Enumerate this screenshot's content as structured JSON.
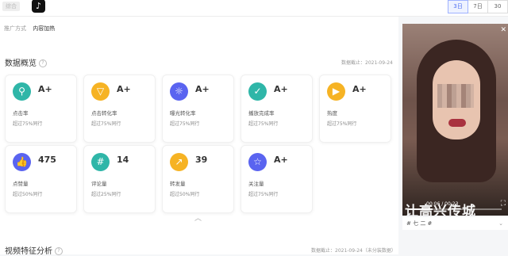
{
  "topbar": {
    "tag": "综合",
    "logo_glyph": "♪",
    "time_range": [
      "3日",
      "7日",
      "30"
    ],
    "active_range": "3日"
  },
  "crumb": {
    "label": "推广方式",
    "current": "内容加热"
  },
  "overview": {
    "title": "数据概览",
    "help": "?",
    "deadline": "数据截止：2021-09-24"
  },
  "cards": [
    {
      "icon": "location-pin-icon",
      "glyph": "⚲",
      "color": "#2fb6a8",
      "value": "A+",
      "label": "点击率",
      "sub": "超过75%同行"
    },
    {
      "icon": "funnel-icon",
      "glyph": "▽",
      "color": "#f6b324",
      "value": "A+",
      "label": "点击转化率",
      "sub": "超过75%同行"
    },
    {
      "icon": "sun-icon",
      "glyph": "☼",
      "color": "#5a64f0",
      "value": "A+",
      "label": "曝光转化率",
      "sub": "超过75%同行"
    },
    {
      "icon": "check-icon",
      "glyph": "✓",
      "color": "#2fb6a8",
      "value": "A+",
      "label": "播放完成率",
      "sub": "超过75%同行"
    },
    {
      "icon": "play-icon",
      "glyph": "▶",
      "color": "#f6b324",
      "value": "A+",
      "label": "热度",
      "sub": "超过75%同行"
    },
    {
      "icon": "thumbs-up-icon",
      "glyph": "👍",
      "color": "#5a64f0",
      "value": "475",
      "label": "点赞量",
      "sub": "超过50%同行"
    },
    {
      "icon": "hashtag-icon",
      "glyph": "#",
      "color": "#2fb6a8",
      "value": "14",
      "label": "评论量",
      "sub": "超过25%同行"
    },
    {
      "icon": "share-icon",
      "glyph": "↗",
      "color": "#f6b324",
      "value": "39",
      "label": "转发量",
      "sub": "超过50%同行"
    },
    {
      "icon": "star-icon",
      "glyph": "☆",
      "color": "#5a64f0",
      "value": "A+",
      "label": "关注量",
      "sub": "超过75%同行"
    }
  ],
  "collapse_glyph": "︿",
  "video_analysis": {
    "title": "视频特征分析",
    "help": "?",
    "deadline": "数据截止：2021-09-24（未分装数据）"
  },
  "video": {
    "time": "00:06 / 00:23",
    "progress": 0.26,
    "caption": "让高兴传城",
    "close_glyph": "✕",
    "fullscreen_glyph": "⛶",
    "select_value": "# 七 二 #",
    "select_arrow": "⌄"
  }
}
